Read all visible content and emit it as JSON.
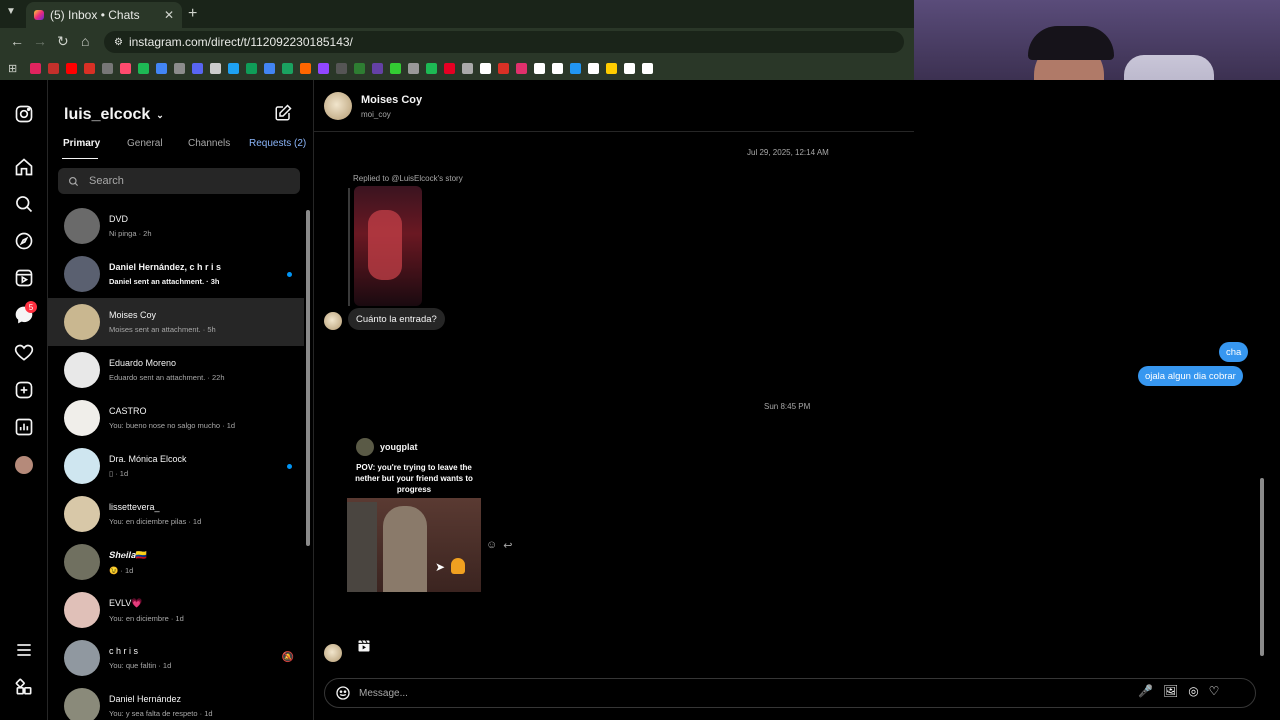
{
  "browser": {
    "tab_title": "(5) Inbox • Chats",
    "url": "instagram.com/direct/t/112092230185143/",
    "bookmark_colors": [
      "#e0245e",
      "#c4302b",
      "#ff0000",
      "#d93025",
      "#777777",
      "#ff4b6e",
      "#1db954",
      "#4285f4",
      "#8c8c8c",
      "#5865f2",
      "#cccccc",
      "#1da1f2",
      "#0f9d58",
      "#4285f4",
      "#1aa260",
      "#ff6600",
      "#9146ff",
      "#555555",
      "#2e7d32",
      "#6441a5",
      "#33cc33",
      "#999999",
      "#1db954",
      "#e60023",
      "#aaaaaa",
      "#ffffff",
      "#d93025",
      "#e1306c",
      "#ffffff",
      "#ffffff",
      "#2196f3",
      "#ffffff",
      "#ffcc00",
      "#ffffff",
      "#ffffff"
    ]
  },
  "rail": {
    "notification_count": "5"
  },
  "inbox": {
    "username": "luis_elcock",
    "tabs": {
      "primary": "Primary",
      "general": "General",
      "channels": "Channels",
      "requests": "Requests (2)"
    },
    "search_placeholder": "Search",
    "conversations": [
      {
        "name": "DVD",
        "preview": "Ni pinga · 2h",
        "unread": false,
        "bold": false,
        "avatar_color": "#6a6a6a"
      },
      {
        "name": "Daniel Hernández, c h r i s",
        "preview": "Daniel sent an attachment. · 3h",
        "unread": true,
        "bold": true,
        "avatar_color": "#5a6070"
      },
      {
        "name": "Moises Coy",
        "preview": "Moises sent an attachment. · 5h",
        "unread": false,
        "bold": false,
        "avatar_color": "#c9b790",
        "active": true
      },
      {
        "name": "Eduardo Moreno",
        "preview": "Eduardo sent an attachment. · 22h",
        "unread": false,
        "bold": false,
        "avatar_color": "#e8e8e8"
      },
      {
        "name": "CASTRO",
        "preview": "You: bueno nose no salgo mucho · 1d",
        "unread": false,
        "bold": false,
        "avatar_color": "#f0eeea"
      },
      {
        "name": "Dra. Mónica Elcock",
        "preview": "▯ · 1d",
        "unread": true,
        "bold": false,
        "avatar_color": "#cfe6f0"
      },
      {
        "name": "lissettevera_",
        "preview": "You: en diciembre pilas · 1d",
        "unread": false,
        "bold": false,
        "avatar_color": "#d8c8a8"
      },
      {
        "name": "𝑺𝒉𝒆𝒊𝒍𝒂🇨🇴",
        "preview": "😉 · 1d",
        "unread": false,
        "bold": false,
        "avatar_color": "#707060"
      },
      {
        "name": "EVLV💗",
        "preview": "You: en diciembre · 1d",
        "unread": false,
        "bold": false,
        "avatar_color": "#e0c0b8"
      },
      {
        "name": "c h r i s",
        "preview": "You: que faltin · 1d",
        "unread": false,
        "bold": false,
        "avatar_color": "#9098a0",
        "muted": true
      },
      {
        "name": "Daniel Hernández",
        "preview": "You: y sea falta de respeto · 1d",
        "unread": false,
        "bold": false,
        "avatar_color": "#8a8a7a"
      }
    ]
  },
  "chat": {
    "name": "Moises Coy",
    "username": "moi_coy",
    "timestamp_1": "Jul 29, 2025, 12:14 AM",
    "reply_note": "Replied to @LuisElcock's story",
    "incoming_message": "Cuánto la entrada?",
    "outgoing_1": "cha",
    "outgoing_2": "ojala algun dia cobrar",
    "timestamp_2": "Sun 8:45 PM",
    "shared_post": {
      "author": "yougplat",
      "caption": "POV: you're trying to leave the nether but your friend wants to progress"
    },
    "composer_placeholder": "Message..."
  },
  "colors": {
    "accent_blue": "#3797f0",
    "unread_dot": "#0095f6",
    "badge_red": "#ff3040",
    "incoming_bubble": "#262626"
  }
}
